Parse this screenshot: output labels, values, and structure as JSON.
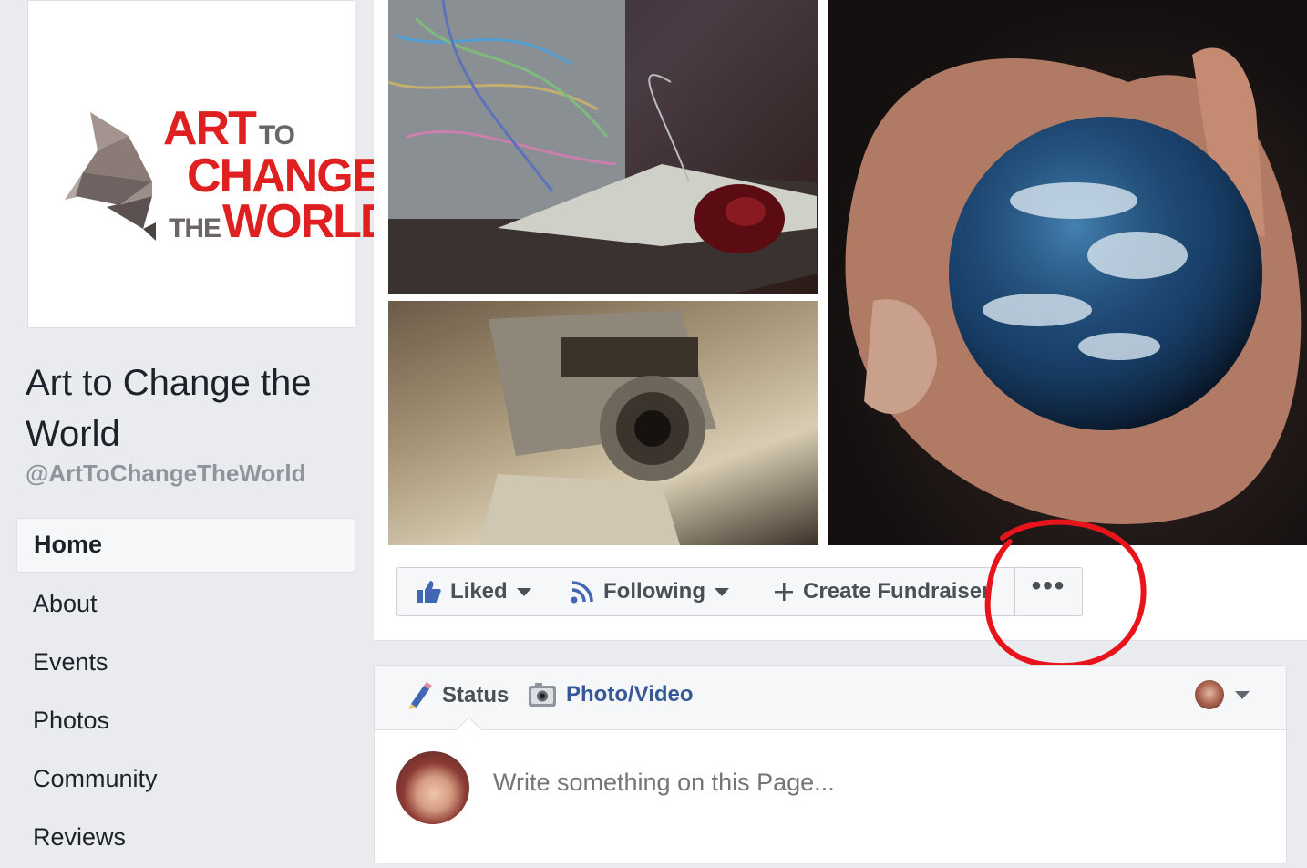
{
  "logo": {
    "line1": "ART",
    "line1_small": "TO",
    "line2": "CHANGE",
    "line3_small": "THE",
    "line3": "WORLD",
    "brand_red": "#e02020",
    "brand_gray": "#6b6665"
  },
  "page": {
    "name": "Art to Change the World",
    "handle": "@ArtToChangeTheWorld"
  },
  "nav": {
    "items": [
      {
        "label": "Home",
        "active": true
      },
      {
        "label": "About"
      },
      {
        "label": "Events"
      },
      {
        "label": "Photos"
      },
      {
        "label": "Community"
      },
      {
        "label": "Reviews"
      }
    ]
  },
  "actions": {
    "liked_label": "Liked",
    "following_label": "Following",
    "fundraiser_label": "Create Fundraiser",
    "more_label": "•••"
  },
  "composer": {
    "status_label": "Status",
    "photo_label": "Photo/Video",
    "placeholder": "Write something on this Page..."
  },
  "colors": {
    "background": "#e9ebee",
    "link_blue": "#365899",
    "fb_blue": "#4267b2",
    "highlight_red": "#e8141b"
  },
  "icons": {
    "liked": "thumbs-up-icon",
    "following": "rss-icon",
    "fundraiser": "plus-icon",
    "status": "pencil-icon",
    "photo": "camera-icon"
  }
}
